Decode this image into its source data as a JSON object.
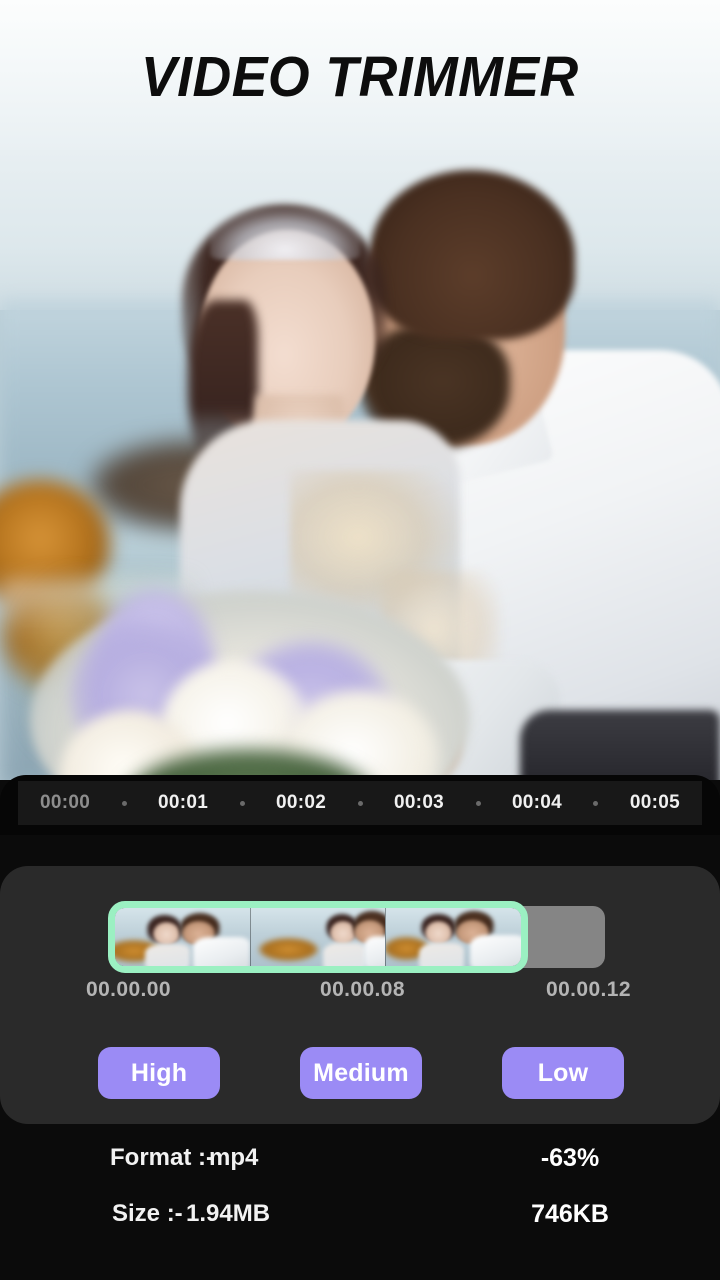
{
  "header": {
    "title": "VIDEO TRIMMER"
  },
  "preview": {
    "alt": "wedding-couple-seaside-photo"
  },
  "timeline": {
    "ticks": [
      "00:00",
      "00:01",
      "00:02",
      "00:03",
      "00:04",
      "00:05"
    ],
    "separator_icon": "dot-separator-icon"
  },
  "trim": {
    "start_label": "00.00.00",
    "playhead_label": "00.00.08",
    "end_label": "00.00.12",
    "selection_border_color": "#9bf0c2",
    "unselected_color": "#858585",
    "frame_count": 3
  },
  "quality": {
    "options": [
      {
        "label": "High"
      },
      {
        "label": "Medium"
      },
      {
        "label": "Low"
      }
    ],
    "button_color": "#9b8bf5"
  },
  "info": {
    "rows": [
      {
        "key": "Format :-",
        "value": "mp4",
        "right": "-63%"
      },
      {
        "key": "Size :-",
        "value": "1.94MB",
        "right": "746KB"
      }
    ]
  },
  "colors": {
    "panel_bg": "#2a2a2a",
    "page_bg": "#0b0b0b",
    "ruler_strip": "#181818",
    "header_gradient_top": "#fcfdfd",
    "header_gradient_bottom": "#e9f0f3"
  }
}
